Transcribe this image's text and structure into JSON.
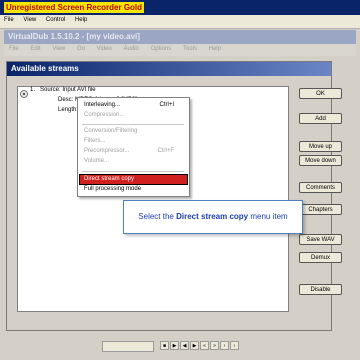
{
  "outer_window": {
    "title": "Unregistered Screen Recorder Gold",
    "menu": [
      "File",
      "View",
      "Control",
      "Help"
    ]
  },
  "vd_window": {
    "title": "VirtualDub 1.5.10.2 - [my video.avi]",
    "menu": [
      "File",
      "Edit",
      "View",
      "Go",
      "Video",
      "Audio",
      "Options",
      "Tools",
      "Help"
    ]
  },
  "dialog": {
    "title": "Available streams",
    "stream": {
      "line1": "Source: Input AVI file",
      "line2": "Desc: MPEG-1 Layer 3 [MP3]",
      "line3": "Length:"
    },
    "buttons": [
      "OK",
      "Add",
      "Move up",
      "Move down",
      "Comments",
      "Chapters",
      "Save WAV",
      "Demux",
      "Disable"
    ]
  },
  "context_menu": {
    "items": [
      {
        "label": "Interleaving...",
        "shortcut": "Ctrl+I",
        "disabled": false
      },
      {
        "label": "Compression...",
        "shortcut": "",
        "disabled": true
      },
      {
        "label": "Conversion/Filtering",
        "shortcut": "",
        "disabled": true
      },
      {
        "label": "Filters...",
        "shortcut": "",
        "disabled": true
      },
      {
        "label": "Precompressor...",
        "shortcut": "Ctrl+F",
        "disabled": true
      },
      {
        "label": "Volume...",
        "shortcut": "",
        "disabled": true
      },
      {
        "label": "Direct stream copy",
        "shortcut": "",
        "disabled": false,
        "highlighted": true
      },
      {
        "label": "Full processing mode",
        "shortcut": "",
        "disabled": false
      }
    ]
  },
  "callout": {
    "prefix": "Select the ",
    "bold": "Direct stream copy",
    "suffix": " menu item"
  },
  "colors": {
    "callout_text": "#1a3fb0",
    "highlight": "#d02020",
    "title_bar": "#0a246a"
  }
}
